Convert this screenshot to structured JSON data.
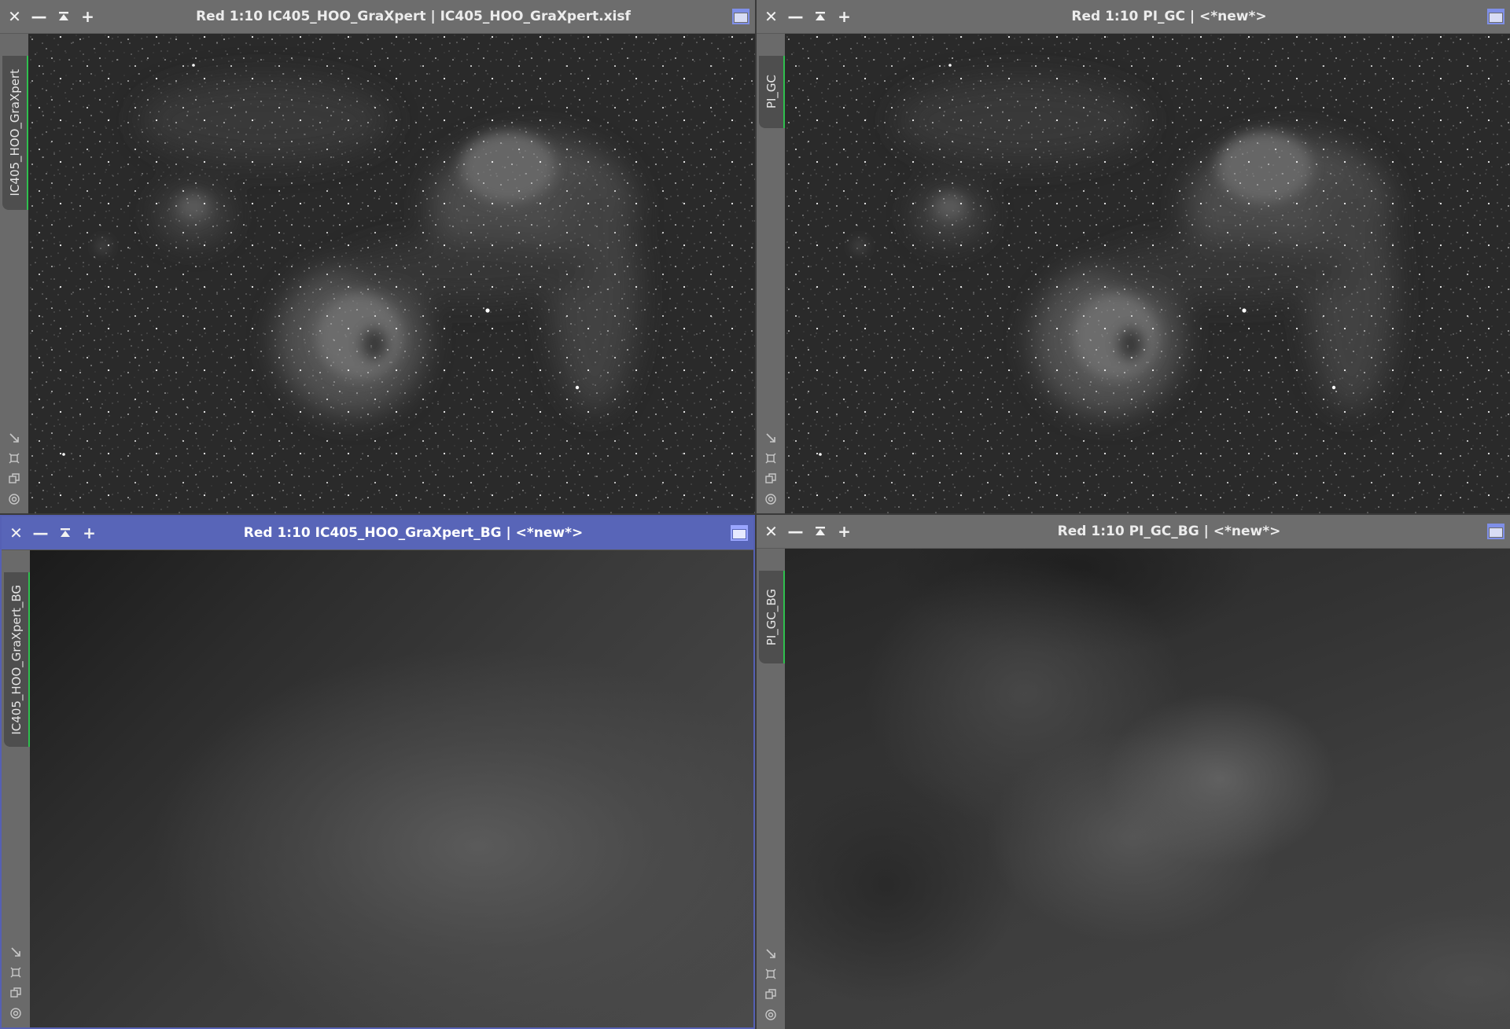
{
  "windows": [
    {
      "id": "top-left",
      "title": "Red 1:10 IC405_HOO_GraXpert | IC405_HOO_GraXpert.xisf",
      "tab_label": "IC405_HOO_GraXpert",
      "active": false,
      "content": "nebula-image"
    },
    {
      "id": "top-right",
      "title": "Red 1:10 PI_GC | <*new*>",
      "tab_label": "PI_GC",
      "active": false,
      "content": "nebula-image"
    },
    {
      "id": "bottom-left",
      "title": "Red 1:10 IC405_HOO_GraXpert_BG | <*new*>",
      "tab_label": "IC405_HOO_GraXpert_BG",
      "active": true,
      "content": "background-model-smooth"
    },
    {
      "id": "bottom-right",
      "title": "Red 1:10 PI_GC_BG | <*new*>",
      "tab_label": "PI_GC_BG",
      "active": false,
      "content": "background-model-blotchy"
    }
  ],
  "colors": {
    "active_titlebar": "#5865b8",
    "titlebar": "#6d6d6d",
    "tab_accent": "#2fbf4e"
  }
}
